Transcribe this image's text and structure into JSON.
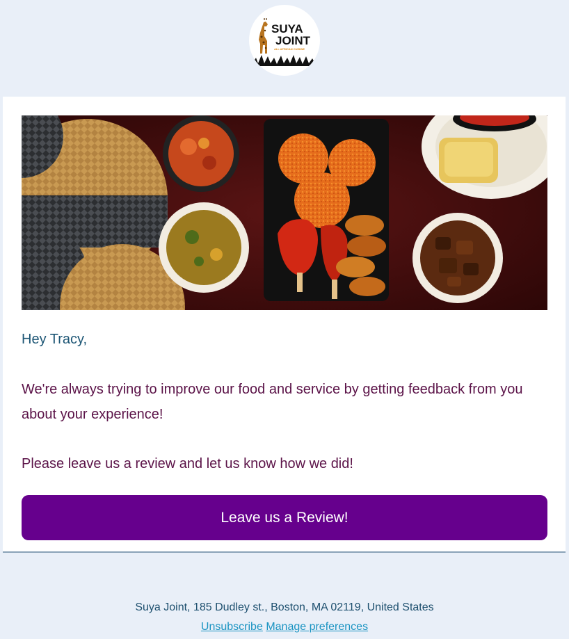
{
  "logo": {
    "brand_line1": "SUYA",
    "brand_line2": "JOINT",
    "tagline": "ALL AFRICAN CUISINE"
  },
  "email": {
    "greeting": "Hey Tracy,",
    "paragraph1": "We're always trying to improve our food and service by getting feedback from you about your experience!",
    "paragraph2": "Please leave us a review and let us know how we did!",
    "cta_label": "Leave us a Review!"
  },
  "footer": {
    "address": "Suya Joint, 185 Dudley st., Boston, MA 02119, United States",
    "unsubscribe_label": "Unsubscribe",
    "manage_label": "Manage preferences"
  },
  "colors": {
    "page_bg": "#e9eff8",
    "cta_bg": "#66008d",
    "greeting_text": "#1d5675",
    "body_text": "#5b1348",
    "link": "#1b94c2"
  }
}
